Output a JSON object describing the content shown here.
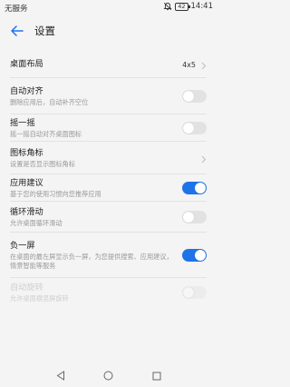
{
  "status_bar": {
    "carrier": "无服务",
    "battery": "42",
    "time": "14:41",
    "icons": [
      "mute-icon",
      "battery-icon"
    ]
  },
  "header": {
    "title": "设置",
    "back_icon": "back-arrow-icon"
  },
  "settings": [
    {
      "key": "layout",
      "label": "桌面布局",
      "value": "4x5",
      "type": "link"
    },
    {
      "key": "auto_align",
      "label": "自动对齐",
      "desc": "删除应用后，自动补齐空位",
      "type": "toggle",
      "on": false
    },
    {
      "key": "shake",
      "label": "摇一摇",
      "desc": "摇一摇自动对齐桌面图标",
      "type": "toggle",
      "on": false
    },
    {
      "key": "badge",
      "label": "图标角标",
      "desc": "设置是否显示图标角标",
      "type": "link"
    },
    {
      "key": "app_suggest",
      "label": "应用建议",
      "desc": "基于您的使用习惯向您推荐应用",
      "type": "toggle",
      "on": true
    },
    {
      "key": "loop_scroll",
      "label": "循环滑动",
      "desc": "允许桌面循环滑动",
      "type": "toggle",
      "on": false
    },
    {
      "key": "minus_one",
      "label": "负一屏",
      "desc": "在桌面的最左屏显示负一屏，为您提供搜索、应用建议，情景智能等服务",
      "type": "toggle",
      "on": true
    },
    {
      "key": "auto_rotate",
      "label": "自动旋转",
      "desc": "允许桌面横竖屏旋转",
      "type": "toggle",
      "on": false,
      "disabled": true
    }
  ],
  "colors": {
    "accent": "#1d74e8",
    "background": "#f4f4f4",
    "toggle_off": "#e2e2e2"
  },
  "nav_bar": [
    "back-triangle-icon",
    "home-circle-icon",
    "recents-square-icon"
  ]
}
